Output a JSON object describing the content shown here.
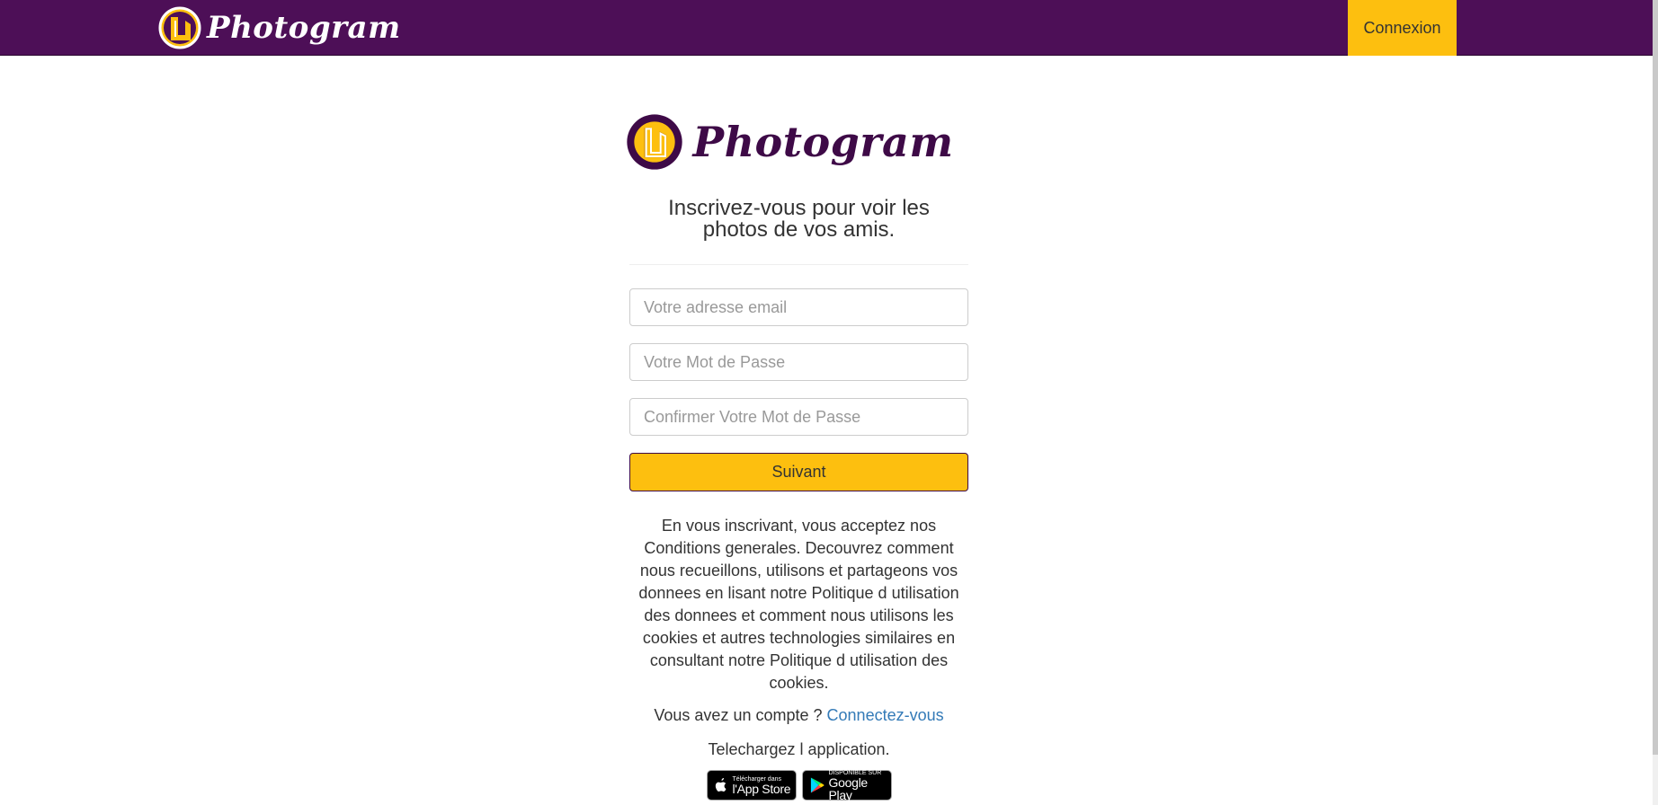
{
  "header": {
    "brand": "Photogram",
    "login_button": "Connexion"
  },
  "colors": {
    "nav_bg": "#4d0f57",
    "accent": "#fdbf0f",
    "brand_purple": "#3e0a47",
    "link": "#337ab7"
  },
  "signup": {
    "brand": "Photogram",
    "tagline": "Inscrivez-vous pour voir les photos de vos amis.",
    "email_placeholder": "Votre adresse email",
    "password_placeholder": "Votre Mot de Passe",
    "confirm_placeholder": "Confirmer Votre Mot de Passe",
    "submit_label": "Suivant",
    "terms": "En vous inscrivant, vous acceptez nos Conditions generales. Decouvrez comment nous recueillons, utilisons et partageons vos donnees en lisant notre Politique d utilisation des donnees et comment nous utilisons les cookies et autres technologies similaires en consultant notre Politique d utilisation des cookies.",
    "have_account": "Vous avez un compte ?",
    "login_link": "Connectez-vous",
    "download": "Telechargez l application."
  },
  "badges": {
    "appstore_small": "Télécharger dans",
    "appstore_big": "l'App Store",
    "googleplay_small": "DISPONIBLE SUR",
    "googleplay_big": "Google Play"
  }
}
